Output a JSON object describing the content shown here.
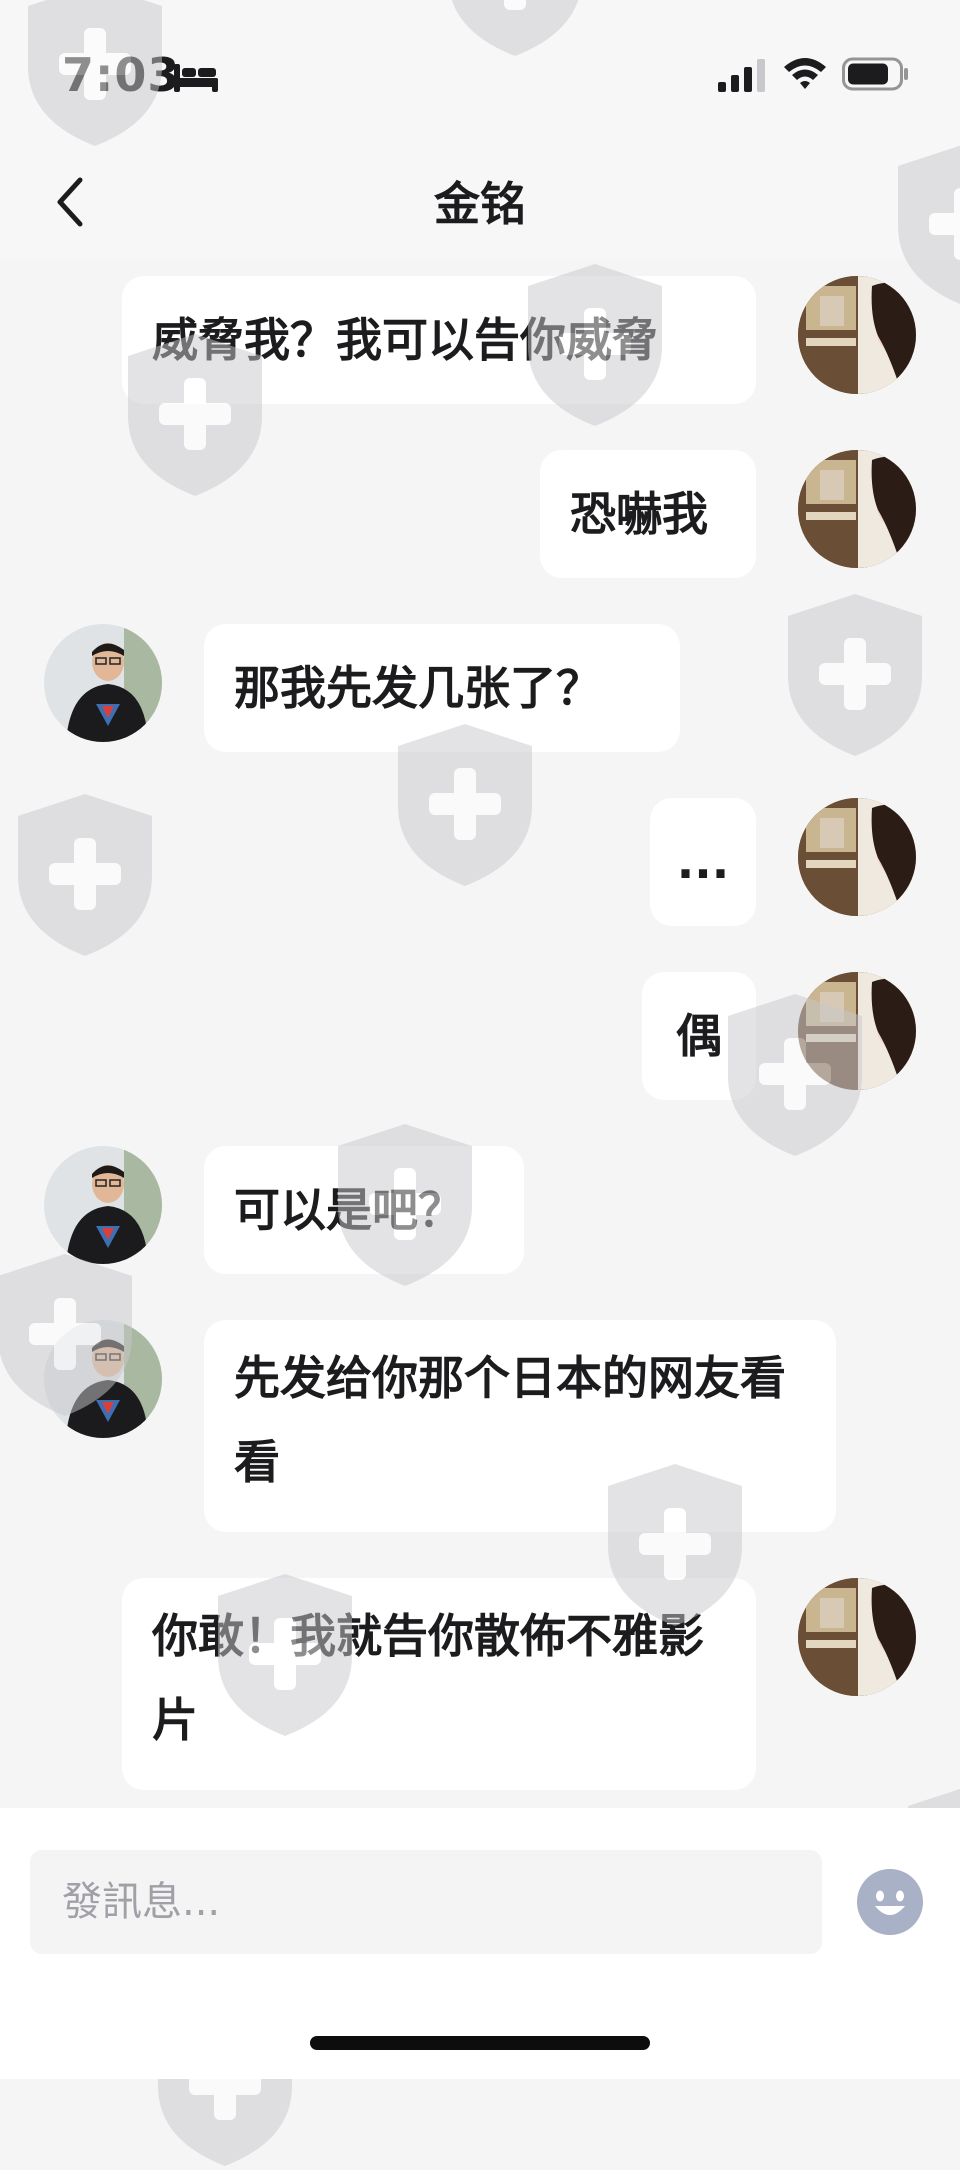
{
  "status_bar": {
    "time": "7:03"
  },
  "header": {
    "title": "金铭"
  },
  "messages": [
    {
      "side": "right",
      "text": "威脅我？我可以告你威脅"
    },
    {
      "side": "right",
      "text": "恐嚇我"
    },
    {
      "side": "left",
      "text": "那我先发几张了？"
    },
    {
      "side": "right",
      "text": "..."
    },
    {
      "side": "right",
      "text": "偶"
    },
    {
      "side": "left",
      "text": "可以是吧？"
    },
    {
      "side": "left",
      "text": "先发给你那个日本的网友看看"
    },
    {
      "side": "right",
      "text": "你敢！我就告你散佈不雅影片"
    }
  ],
  "input": {
    "placeholder": "發訊息..."
  },
  "colors": {
    "background": "#f5f5f6",
    "bubble": "#ffffff",
    "text": "#1c1c1e",
    "placeholder": "#a0a0a6",
    "emoji_button": "#a9b1c6"
  },
  "icons": [
    "bed-icon",
    "signal-icon",
    "wifi-icon",
    "battery-icon",
    "back-icon",
    "emoji-icon",
    "watermark-shield-icon"
  ]
}
